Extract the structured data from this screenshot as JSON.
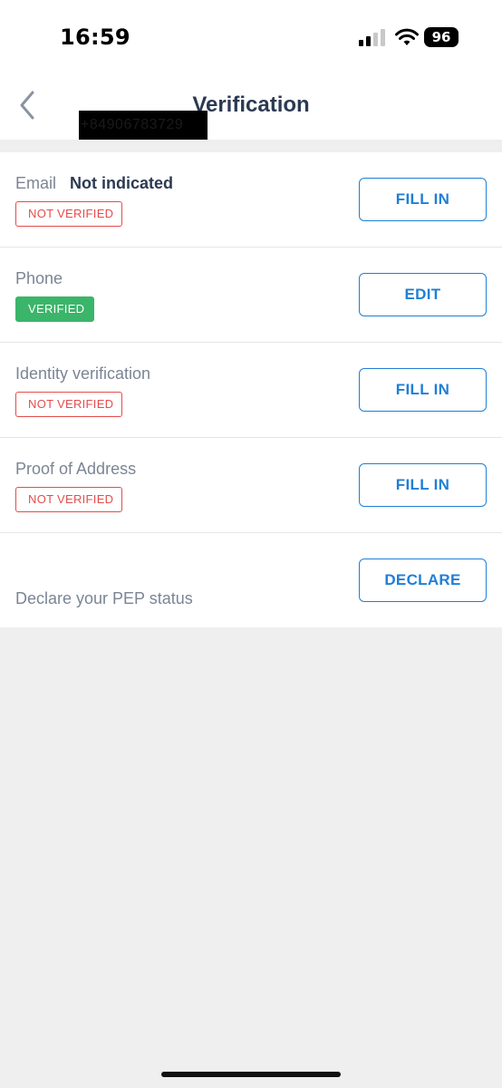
{
  "status_bar": {
    "time": "16:59",
    "battery": "96",
    "icons": [
      "signal-icon",
      "wifi-icon",
      "battery-icon"
    ]
  },
  "header": {
    "back_icon": "chevron-left-icon",
    "title": "Verification"
  },
  "rows": [
    {
      "label": "Email",
      "value": "Not indicated",
      "status": "NOT VERIFIED",
      "action": "FILL IN"
    },
    {
      "label": "Phone",
      "value": "+84906783729",
      "status": "VERIFIED",
      "action": "EDIT"
    },
    {
      "label": "Identity verification",
      "status": "NOT VERIFIED",
      "action": "FILL IN"
    },
    {
      "label": "Proof of Address",
      "status": "NOT VERIFIED",
      "action": "FILL IN"
    },
    {
      "label": "Declare your PEP status",
      "action": "DECLARE"
    }
  ],
  "colors": {
    "accent": "#1f7fd6",
    "not_verified": "#e44c4c",
    "verified": "#3bb56a",
    "background": "#efefef"
  }
}
